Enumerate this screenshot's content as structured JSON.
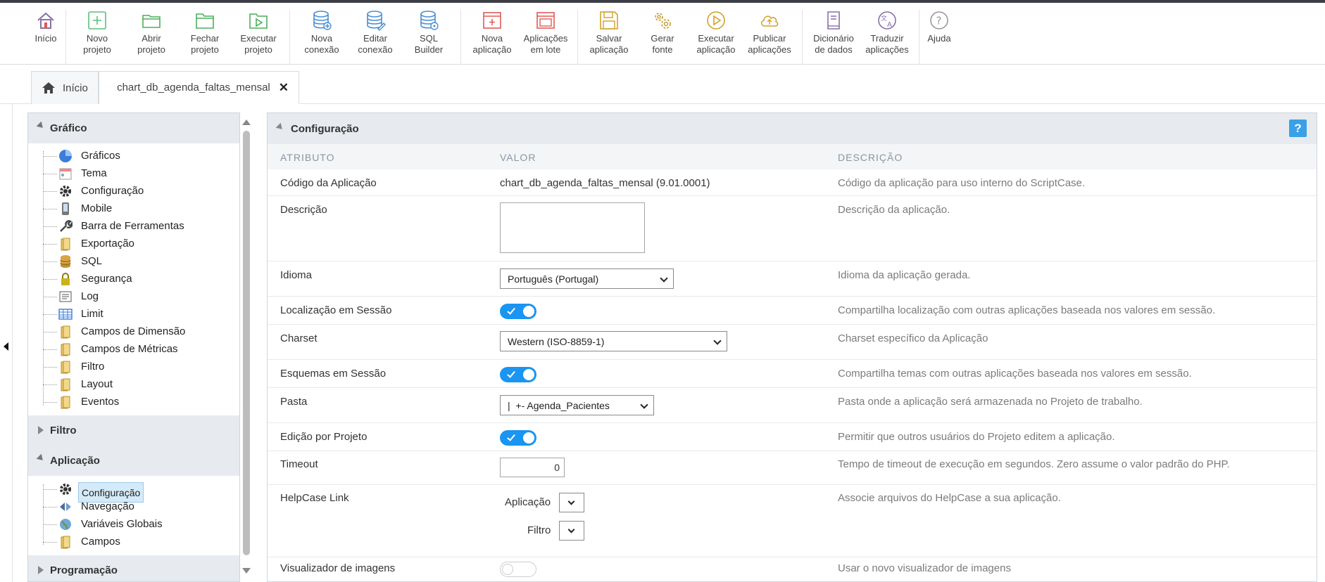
{
  "toolbar": {
    "buttons": [
      {
        "line1": "Início",
        "line2": "",
        "icon": "home-icon"
      },
      {
        "line1": "Novo",
        "line2": "projeto",
        "icon": "new-project-icon"
      },
      {
        "line1": "Abrir",
        "line2": "projeto",
        "icon": "open-folder-icon"
      },
      {
        "line1": "Fechar",
        "line2": "projeto",
        "icon": "close-folder-icon"
      },
      {
        "line1": "Executar",
        "line2": "projeto",
        "icon": "run-project-icon"
      },
      {
        "line1": "Nova",
        "line2": "conexão",
        "icon": "new-connection-icon"
      },
      {
        "line1": "Editar",
        "line2": "conexão",
        "icon": "edit-connection-icon"
      },
      {
        "line1": "SQL",
        "line2": "Builder",
        "icon": "sql-builder-icon"
      },
      {
        "line1": "Nova",
        "line2": "aplicação",
        "icon": "new-app-icon"
      },
      {
        "line1": "Aplicações",
        "line2": "em lote",
        "icon": "batch-apps-icon"
      },
      {
        "line1": "Salvar",
        "line2": "aplicação",
        "icon": "save-icon"
      },
      {
        "line1": "Gerar",
        "line2": "fonte",
        "icon": "gears-icon"
      },
      {
        "line1": "Executar",
        "line2": "aplicação",
        "icon": "play-icon"
      },
      {
        "line1": "Publicar",
        "line2": "aplicações",
        "icon": "cloud-upload-icon"
      },
      {
        "line1": "Dicionário",
        "line2": "de dados",
        "icon": "dictionary-icon"
      },
      {
        "line1": "Traduzir",
        "line2": "aplicações",
        "icon": "translate-icon"
      },
      {
        "line1": "Ajuda",
        "line2": "",
        "icon": "help-icon"
      }
    ]
  },
  "tabs": {
    "home": "Início",
    "app": "chart_db_agenda_faltas_mensal",
    "close": "✕"
  },
  "sidebar": {
    "grafico": {
      "title": "Gráfico",
      "items": [
        "Gráficos",
        "Tema",
        "Configuração",
        "Mobile",
        "Barra de Ferramentas",
        "Exportação",
        "SQL",
        "Segurança",
        "Log",
        "Limit",
        "Campos de Dimensão",
        "Campos de Métricas",
        "Filtro",
        "Layout",
        "Eventos"
      ]
    },
    "filtro": {
      "title": "Filtro"
    },
    "aplicacao": {
      "title": "Aplicação",
      "items": [
        "Configuração",
        "Navegação",
        "Variáveis Globais",
        "Campos"
      ]
    },
    "programacao": {
      "title": "Programação"
    }
  },
  "main": {
    "title": "Configuração",
    "help": "?",
    "columns": {
      "attr": "ATRIBUTO",
      "value": "VALOR",
      "desc": "DESCRIÇÃO"
    },
    "rows": {
      "codigo": {
        "attr": "Código da Aplicação",
        "value": "chart_db_agenda_faltas_mensal (9.01.0001)",
        "desc": "Código da aplicação para uso interno do ScriptCase."
      },
      "descricao": {
        "attr": "Descrição",
        "value": "",
        "desc": "Descrição da aplicação."
      },
      "idioma": {
        "attr": "Idioma",
        "value": "Português (Portugal)",
        "desc": "Idioma da aplicação gerada."
      },
      "localizacao": {
        "attr": "Localização em Sessão",
        "on": true,
        "desc": "Compartilha localização com outras aplicações baseada nos valores em sessão."
      },
      "charset": {
        "attr": "Charset",
        "value": "Western (ISO-8859-1)",
        "desc": "Charset específico da Aplicação"
      },
      "esquemas": {
        "attr": "Esquemas em Sessão",
        "on": true,
        "desc": "Compartilha temas com outras aplicações baseada nos valores em sessão."
      },
      "pasta": {
        "attr": "Pasta",
        "value": "|  +- Agenda_Pacientes",
        "desc": "Pasta onde a aplicação será armazenada no Projeto de trabalho."
      },
      "edicao": {
        "attr": "Edição por Projeto",
        "on": true,
        "desc": "Permitir que outros usuários do Projeto editem a aplicação."
      },
      "timeout": {
        "attr": "Timeout",
        "value": "0",
        "desc": "Tempo de timeout de execução em segundos. Zero assume o valor padrão do PHP."
      },
      "helpcase": {
        "attr": "HelpCase Link",
        "app_label": "Aplicação",
        "filtro_label": "Filtro",
        "desc": "Associe arquivos do HelpCase a sua aplicação."
      },
      "visualizador": {
        "attr": "Visualizador de imagens",
        "on": false,
        "desc": "Usar o novo visualizador de imagens"
      }
    }
  }
}
